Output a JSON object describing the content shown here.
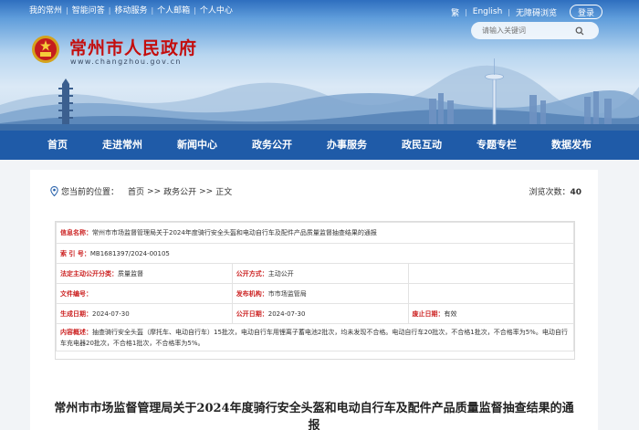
{
  "topbar": {
    "links": [
      "我的常州",
      "智能问答",
      "移动服务",
      "个人邮箱",
      "个人中心"
    ],
    "lang_trad": "繁",
    "lang_en": "English",
    "accessible": "无障碍浏览",
    "login": "登录"
  },
  "search": {
    "placeholder": "请输入关键词"
  },
  "site": {
    "title": "常州市人民政府",
    "url": "www.changzhou.gov.cn"
  },
  "nav": [
    "首页",
    "走进常州",
    "新闻中心",
    "政务公开",
    "办事服务",
    "政民互动",
    "专题专栏",
    "数据发布"
  ],
  "breadcrumb": {
    "prefix": "您当前的位置：",
    "items": [
      "首页",
      "政务公开",
      "正文"
    ],
    "sep": ">>"
  },
  "views": {
    "label": "浏览次数：",
    "count": "40"
  },
  "info": {
    "title_label": "信息名称：",
    "title_value": "常州市市场监督管理局关于2024年度骑行安全头盔和电动自行车及配件产品质量监督抽查结果的通报",
    "index_label": "索  引  号：",
    "index_value": "MB1681397/2024-00105",
    "category_label": "法定主动公开分类：",
    "category_value": "质量监督",
    "method_label": "公开方式：",
    "method_value": "主动公开",
    "docno_label": "文件编号：",
    "docno_value": "",
    "publisher_label": "发布机构：",
    "publisher_value": "市市场监管局",
    "created_label": "生成日期：",
    "created_value": "2024-07-30",
    "published_label": "公开日期：",
    "published_value": "2024-07-30",
    "abolish_label": "废止日期：",
    "abolish_value": "有效",
    "content_label": "内容概述：",
    "content_value": "抽查骑行安全头盔（摩托车、电动自行车）15批次，电动自行车用锂离子蓄电池2批次，均未发现不合格。电动自行车20批次，不合格1批次，不合格率为5%。电动自行车充电器20批次，不合格1批次，不合格率为5%。"
  },
  "doc_title": "常州市市场监督管理局关于2024年度骑行安全头盔和电动自行车及配件产品质量监督抽查结果的通报"
}
